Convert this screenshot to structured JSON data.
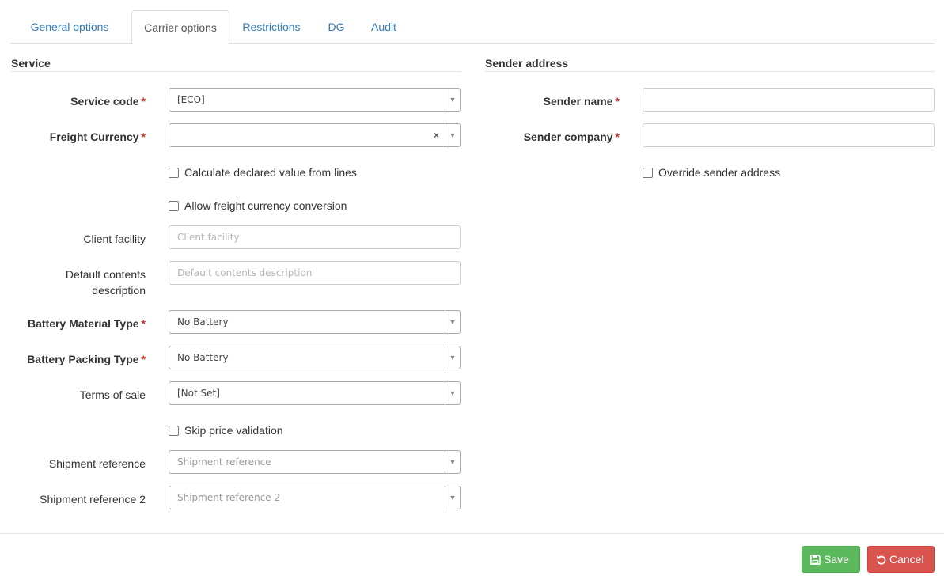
{
  "tabs": [
    {
      "label": "General options",
      "active": false
    },
    {
      "label": "Carrier options",
      "active": true
    },
    {
      "label": "Restrictions",
      "active": false
    },
    {
      "label": "DG",
      "active": false
    },
    {
      "label": "Audit",
      "active": false
    }
  ],
  "service": {
    "title": "Service",
    "service_code": {
      "label": "Service code",
      "value": "[ECO]"
    },
    "freight_currency": {
      "label": "Freight Currency",
      "value": "",
      "clear": "×"
    },
    "calc_declared": {
      "label": "Calculate declared value from lines",
      "checked": false
    },
    "allow_conversion": {
      "label": "Allow freight currency conversion",
      "checked": false
    },
    "client_facility": {
      "label": "Client facility",
      "placeholder": "Client facility",
      "value": ""
    },
    "default_contents": {
      "label_line1": "Default contents",
      "label_line2": "description",
      "placeholder": "Default contents description",
      "value": ""
    },
    "battery_material": {
      "label": "Battery Material Type",
      "value": "No Battery"
    },
    "battery_packing": {
      "label": "Battery Packing Type",
      "value": "No Battery"
    },
    "terms_of_sale": {
      "label": "Terms of sale",
      "value": "[Not Set]"
    },
    "skip_price": {
      "label": "Skip price validation",
      "checked": false
    },
    "shipment_ref": {
      "label": "Shipment reference",
      "placeholder": "Shipment reference"
    },
    "shipment_ref2": {
      "label": "Shipment reference 2",
      "placeholder": "Shipment reference 2"
    }
  },
  "sender": {
    "title": "Sender address",
    "name": {
      "label": "Sender name",
      "value": ""
    },
    "company": {
      "label": "Sender company",
      "value": ""
    },
    "override": {
      "label": "Override sender address",
      "checked": false
    }
  },
  "required_marker": "*",
  "dropdown_arrow": "▼",
  "footer": {
    "save_label": "Save",
    "cancel_label": "Cancel"
  },
  "colors": {
    "link": "#337ab7",
    "save": "#5cb85c",
    "cancel": "#d9534f",
    "required": "#c9302c"
  }
}
